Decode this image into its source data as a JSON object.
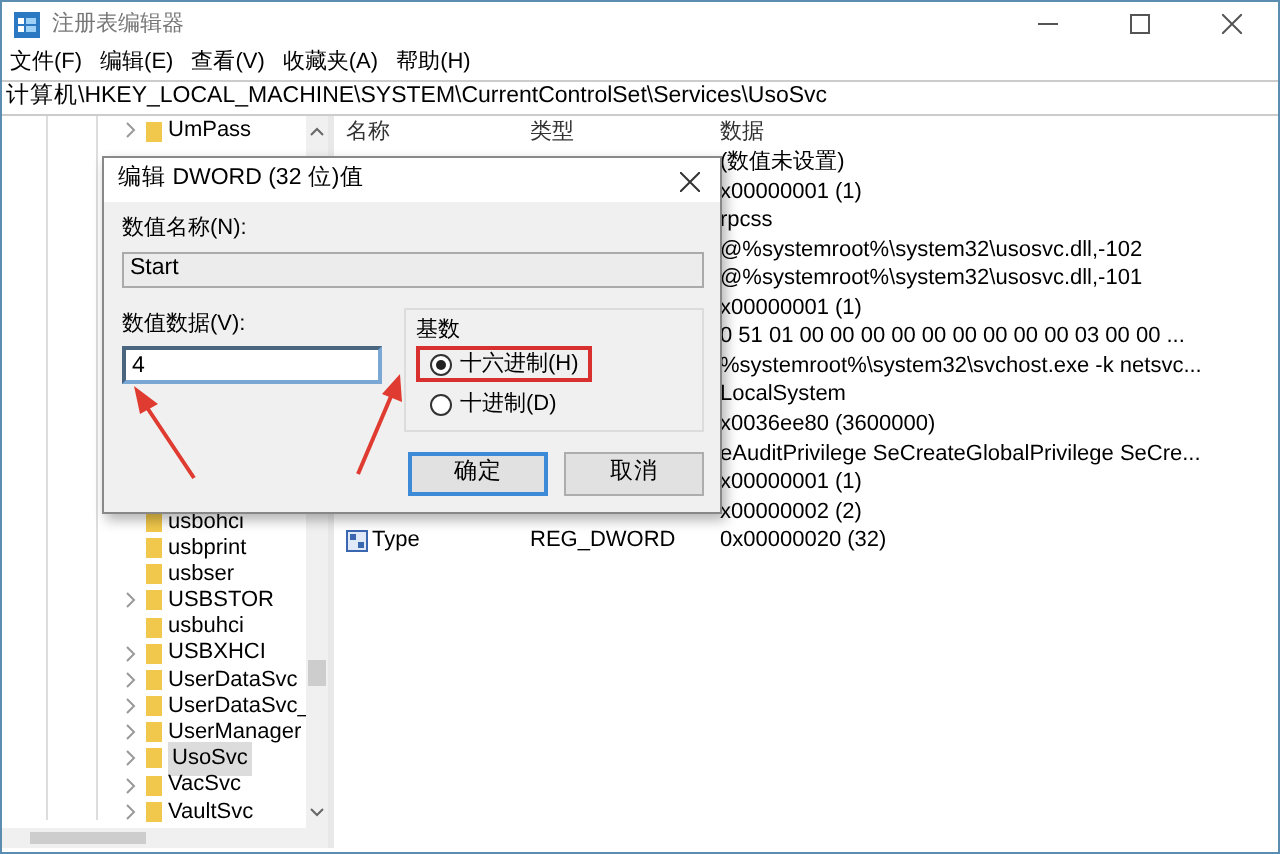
{
  "window": {
    "title": "注册表编辑器"
  },
  "menu": [
    "文件(F)",
    "编辑(E)",
    "查看(V)",
    "收藏夹(A)",
    "帮助(H)"
  ],
  "address": "计算机\\HKEY_LOCAL_MACHINE\\SYSTEM\\CurrentControlSet\\Services\\UsoSvc",
  "tree": {
    "top_items": [
      {
        "label": "UmPass",
        "expandable": true,
        "selected": false
      }
    ],
    "bottom_items": [
      {
        "label": "usbohci",
        "expandable": false,
        "selected": false
      },
      {
        "label": "usbprint",
        "expandable": false,
        "selected": false
      },
      {
        "label": "usbser",
        "expandable": false,
        "selected": false
      },
      {
        "label": "USBSTOR",
        "expandable": true,
        "selected": false
      },
      {
        "label": "usbuhci",
        "expandable": false,
        "selected": false
      },
      {
        "label": "USBXHCI",
        "expandable": true,
        "selected": false
      },
      {
        "label": "UserDataSvc",
        "expandable": true,
        "selected": false
      },
      {
        "label": "UserDataSvc_",
        "expandable": true,
        "selected": false
      },
      {
        "label": "UserManager",
        "expandable": true,
        "selected": false
      },
      {
        "label": "UsoSvc",
        "expandable": true,
        "selected": true
      },
      {
        "label": "VacSvc",
        "expandable": true,
        "selected": false
      },
      {
        "label": "VaultSvc",
        "expandable": true,
        "selected": false
      }
    ]
  },
  "list": {
    "columns": [
      "名称",
      "类型",
      "数据"
    ],
    "rows": [
      {
        "data": "(数值未设置)"
      },
      {
        "data": "x00000001 (1)"
      },
      {
        "data": "rpcss"
      },
      {
        "data": "@%systemroot%\\system32\\usosvc.dll,-102"
      },
      {
        "data": "@%systemroot%\\system32\\usosvc.dll,-101"
      },
      {
        "data": "x00000001 (1)"
      },
      {
        "data": "0 51 01 00 00 00 00 00 00 00 00 00 03 00 00 ..."
      },
      {
        "data": "%systemroot%\\system32\\svchost.exe -k netsvc..."
      },
      {
        "data": "LocalSystem"
      },
      {
        "data": "x0036ee80 (3600000)"
      },
      {
        "data": "eAuditPrivilege SeCreateGlobalPrivilege SeCre..."
      },
      {
        "data": "x00000001 (1)"
      },
      {
        "data": "x00000002 (2)"
      },
      {
        "name": "Type",
        "type": "REG_DWORD",
        "data": "0x00000020 (32)"
      }
    ]
  },
  "dialog": {
    "title": "编辑 DWORD (32 位)值",
    "name_label": "数值名称(N):",
    "name_value": "Start",
    "data_label": "数值数据(V):",
    "data_value": "4",
    "base_label": "基数",
    "radios": [
      {
        "label": "十六进制(H)",
        "selected": true,
        "highlighted": true
      },
      {
        "label": "十进制(D)",
        "selected": false,
        "highlighted": false
      }
    ],
    "buttons": [
      {
        "label": "确定",
        "default": true
      },
      {
        "label": "取消",
        "default": false
      }
    ]
  }
}
